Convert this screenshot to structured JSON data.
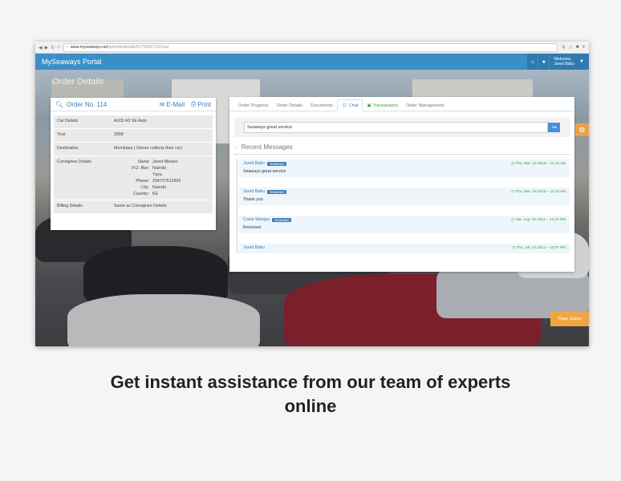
{
  "browser": {
    "url": "www.myseaways.net",
    "url_path": "/getorderdetails/6179963713#chat"
  },
  "app": {
    "brand": "MySeaways Portal",
    "welcome_line1": "Welcome,",
    "welcome_name": "Jared Babu",
    "page_title": "Order Details"
  },
  "order": {
    "number": "Order No. 114",
    "email_label": "E-Mail",
    "print_label": "Print",
    "rows": [
      {
        "key": "Car Details",
        "value": "AUDI A3 SE Auto"
      },
      {
        "key": "Year",
        "value": "2008"
      },
      {
        "key": "Destination",
        "value": "Mombasa ( Owner collects their car)"
      }
    ],
    "consignee_label": "Consignee Details",
    "consignee": [
      {
        "k": "Name",
        "v": "Jared Mwazo"
      },
      {
        "k": "P.O. Box:",
        "v": "Nairobi"
      },
      {
        "k": "",
        "v": "Yaya"
      },
      {
        "k": "Phone:",
        "v": "254737513493"
      },
      {
        "k": "City:",
        "v": "Nairobi"
      },
      {
        "k": "Country:",
        "v": "KE"
      }
    ],
    "billing_label": "Billing Details",
    "billing_value": "Same as Consignee Details"
  },
  "tabs": [
    "Order Progress",
    "Order Details",
    "Documents",
    "Chat",
    "Transactions",
    "Order Management"
  ],
  "chat": {
    "input_value": "Seaways great service",
    "recent_title": "Recent Messages",
    "messages": [
      {
        "sender": "Jared Babu",
        "badge": "Seaways",
        "time": "Thu, Mar. 19 2015 – 11:19 AM",
        "text": "Seaways great service"
      },
      {
        "sender": "Jared Babu",
        "badge": "Seaways",
        "time": "Thu, Mar. 19 2015 – 11:18 AM",
        "text": "Thank you"
      },
      {
        "sender": "Caine Wanjau",
        "badge": "Seaways",
        "time": "Sat, Aug. 02 2014 – 12:27 PM",
        "text": "Received"
      },
      {
        "sender": "Jared Babu",
        "badge": "",
        "time": "Thu, Jul. 24 2014 – 12:07 PM",
        "text": ""
      }
    ]
  },
  "page_guide": "Page Guide",
  "caption": "Get instant assistance from our team of experts online",
  "colors": {
    "accent": "#3a8fc8",
    "accent_dark": "#2f7bb0",
    "green": "#3b9a3b",
    "orange": "#f0a640"
  }
}
